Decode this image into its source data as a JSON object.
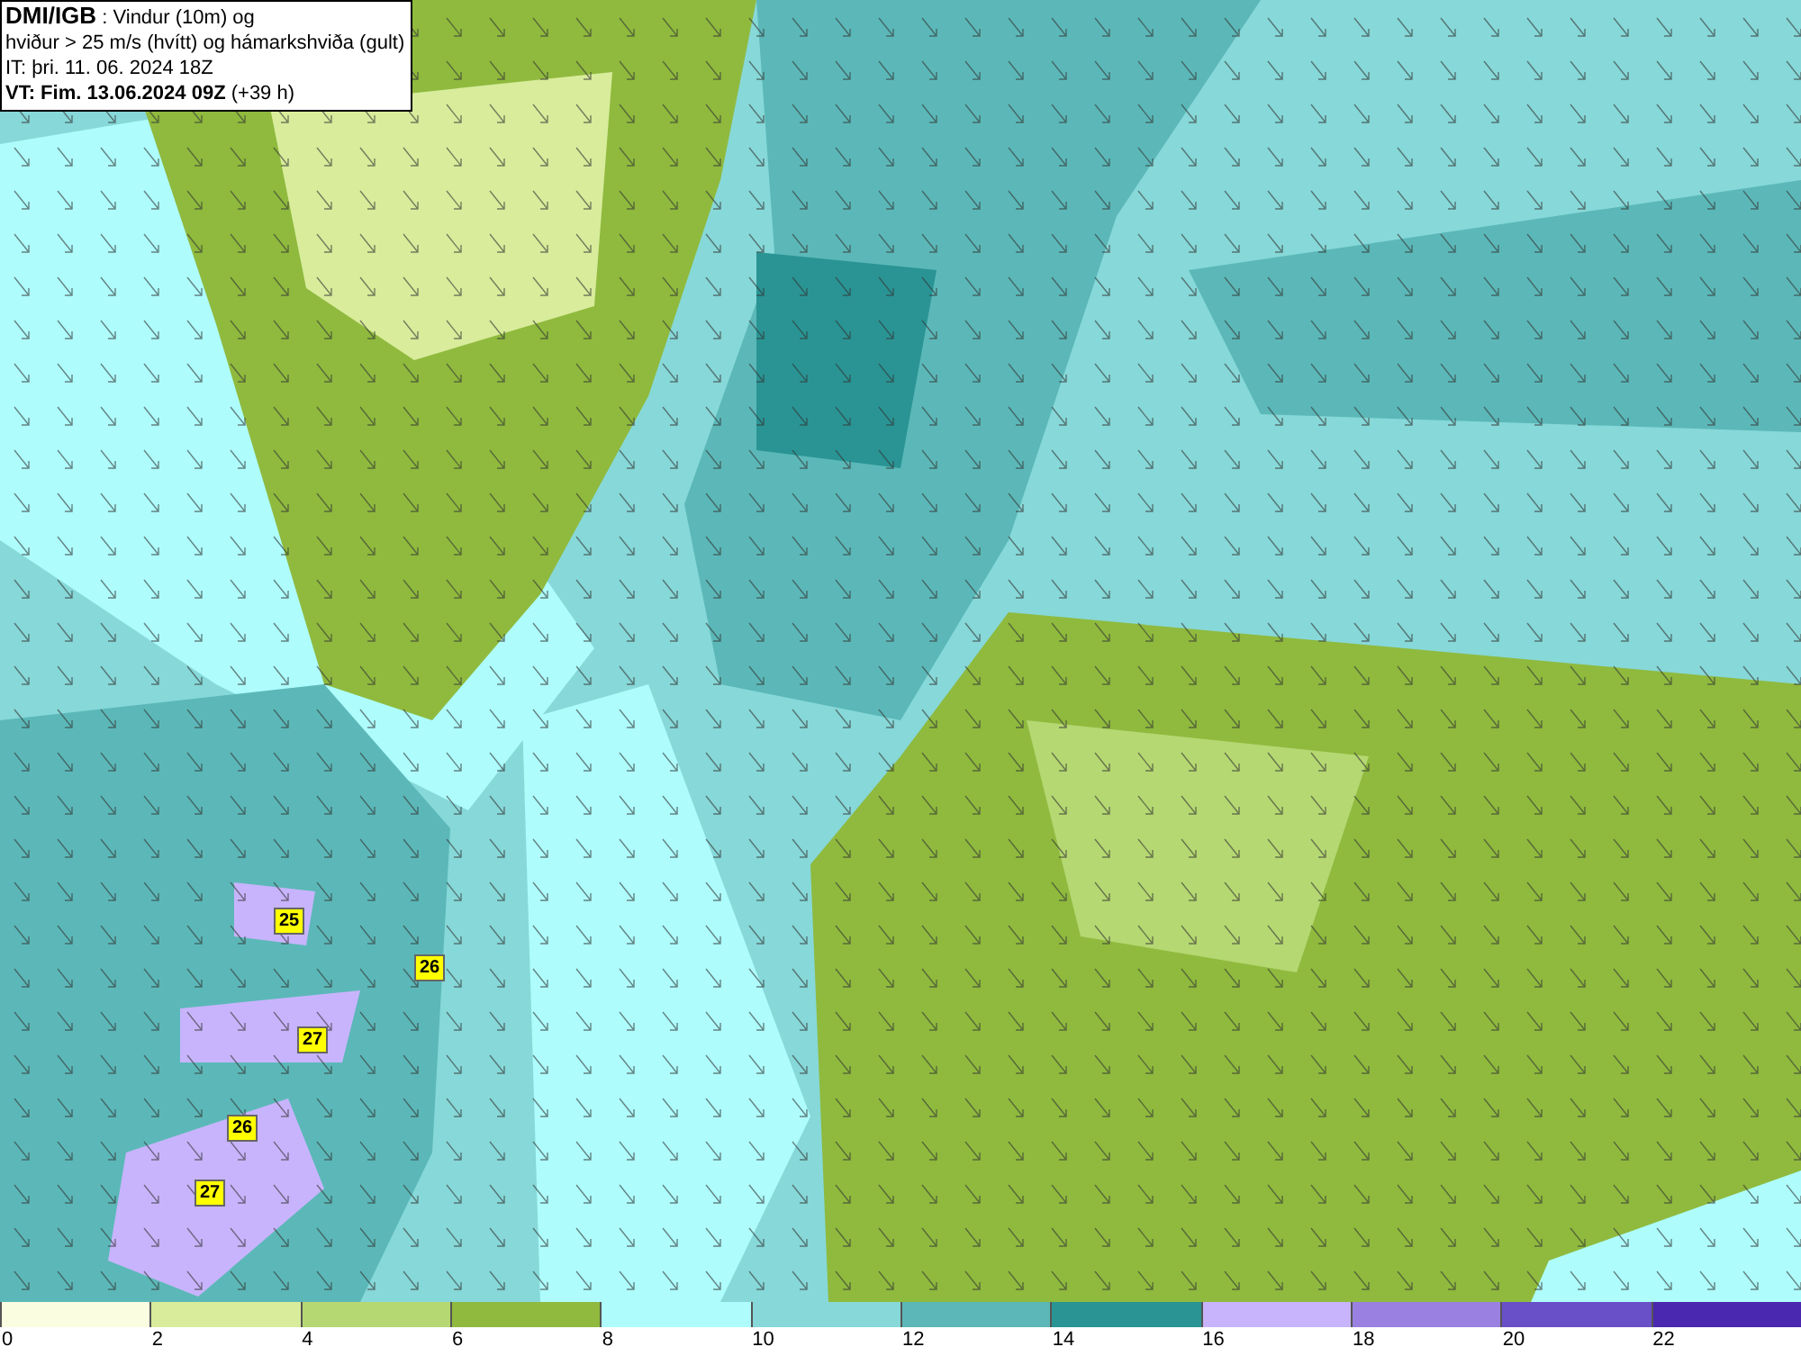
{
  "title_box": {
    "lines": [
      "**DMI/IGB** : Vindur (10m) og",
      "hviður > 25 m/s (hvítt) og hámarkshviða (gult)",
      "IT: þri. 11. 06. 2024 18Z",
      "**VT: Fim. 13.06.2024 09Z** (+39 h)"
    ]
  },
  "map": {
    "gust_labels": [
      "25",
      "26",
      "27",
      "26",
      "27"
    ]
  },
  "legend": [
    {
      "label": "0",
      "color": "#fafde0"
    },
    {
      "label": "2",
      "color": "#d8ec9b"
    },
    {
      "label": "4",
      "color": "#b5d872"
    },
    {
      "label": "6",
      "color": "#8fba3e"
    },
    {
      "label": "8",
      "color": "#aefcfc"
    },
    {
      "label": "10",
      "color": "#87d8d8"
    },
    {
      "label": "12",
      "color": "#5cb8b8"
    },
    {
      "label": "14",
      "color": "#2a9494"
    },
    {
      "label": "16",
      "color": "#c8b4fc"
    },
    {
      "label": "18",
      "color": "#9a80e0"
    },
    {
      "label": "20",
      "color": "#6a50c8"
    },
    {
      "label": "22",
      "color": "#4a28b0"
    }
  ]
}
